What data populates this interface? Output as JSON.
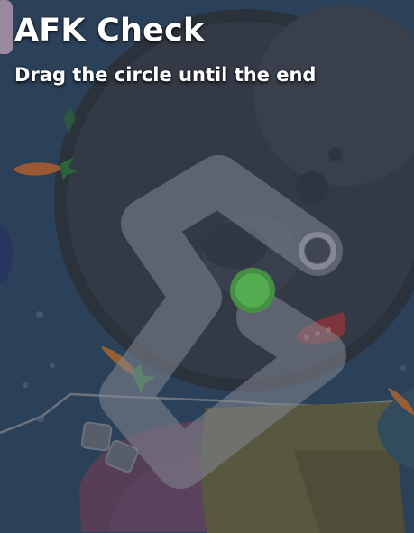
{
  "afk_check": {
    "title": "AFK Check",
    "instruction": "Drag the circle until the end"
  },
  "colors": {
    "handle": "#6ae05c",
    "handle_ring": "#57b84c",
    "track": "#8b909a",
    "planet": "#3a3f4b",
    "water": "#3d5a78"
  },
  "icons": {
    "track_end": "ring-target-icon",
    "handle": "drag-circle-icon"
  }
}
